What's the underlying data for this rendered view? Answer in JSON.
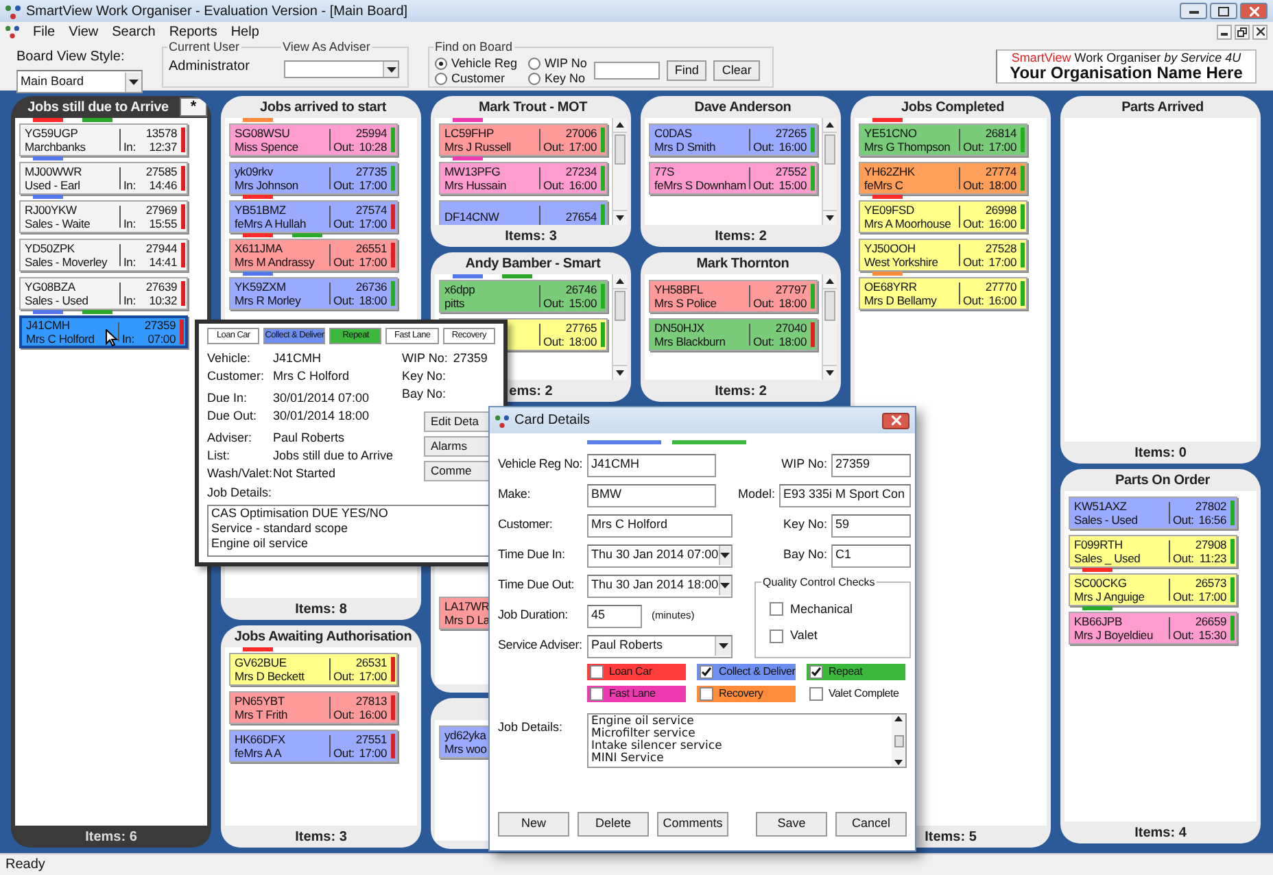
{
  "window": {
    "title": "SmartView Work Organiser - Evaluation Version - [Main Board]"
  },
  "menu": [
    "File",
    "View",
    "Search",
    "Reports",
    "Help"
  ],
  "toolbar": {
    "board_view_style": {
      "label": "Board View Style:",
      "value": "Main Board"
    },
    "current_user": {
      "legend": "Current User",
      "value": "Administrator"
    },
    "view_as_adviser": {
      "label": "View As Adviser"
    },
    "find": {
      "legend": "Find on Board",
      "options": [
        {
          "label": "Vehicle Reg",
          "selected": true
        },
        {
          "label": "WIP No",
          "selected": false
        },
        {
          "label": "Customer",
          "selected": false
        },
        {
          "label": "Key No",
          "selected": false
        }
      ],
      "buttons": [
        "Find",
        "Clear"
      ]
    },
    "logo": {
      "brand": "SmartView",
      "product": "Work Organiser",
      "by": "by Service 4U",
      "organisation": "Your Organisation Name Here"
    }
  },
  "board": {
    "columns": [
      {
        "panels": [
          {
            "title": "Jobs still due to Arrive",
            "action": "*",
            "selected": true,
            "scrollable": false,
            "footer": "Items: 6",
            "cards": [
              {
                "reg": "YG59UGP",
                "name": "Marchbanks",
                "label": "In:",
                "time": "12:37",
                "wip": "13578",
                "color": "#f4f4f4",
                "selected": false,
                "indicator": {
                  "color": "#e02020"
                },
                "flags": [
                  {
                    "color": "#ff2a2a"
                  },
                  {
                    "color": "#2aa82a"
                  }
                ]
              },
              {
                "reg": "MJ00WWR",
                "name": "Used - Earl",
                "label": "In:",
                "time": "14:46",
                "wip": "27585",
                "color": "#f4f4f4",
                "selected": false,
                "indicator": {
                  "color": "#e02020"
                },
                "flags": [
                  {
                    "color": "#5577ee"
                  }
                ]
              },
              {
                "reg": "RJ00YKW",
                "name": "Sales - Waite",
                "label": "In:",
                "time": "15:55",
                "wip": "27969",
                "color": "#f4f4f4",
                "selected": false,
                "indicator": {
                  "color": "#e02020"
                },
                "flags": [
                  {
                    "color": "#5577ee"
                  }
                ]
              },
              {
                "reg": "YD50ZPK",
                "name": "Sales - Moverley",
                "label": "In:",
                "time": "14:41",
                "wip": "27944",
                "color": "#f4f4f4",
                "selected": false,
                "indicator": {
                  "color": "#e02020"
                }
              },
              {
                "reg": "YG08BZA",
                "name": "Sales - Used",
                "label": "In:",
                "time": "10:32",
                "wip": "27639",
                "color": "#f4f4f4",
                "selected": false,
                "indicator": {
                  "color": "#e02020"
                }
              },
              {
                "reg": "J41CMH",
                "name": "Mrs C Holford",
                "label": "In:",
                "time": "07:00",
                "wip": "27359",
                "color": "#3399ff",
                "selected": true,
                "indicator": {
                  "color": "#e02020"
                },
                "flags": [
                  {
                    "color": "#5577ee"
                  },
                  {
                    "color": "#2aa82a"
                  }
                ]
              }
            ]
          }
        ]
      },
      {
        "panels": [
          {
            "title": "Jobs arrived to start",
            "selected": false,
            "scrollable": false,
            "footer": "Items: 8",
            "cards": [
              {
                "reg": "SG08WSU",
                "name": "Miss Spence",
                "label": "Out:",
                "time": "10:28",
                "wip": "25994",
                "color": "#ff9ccf",
                "selected": false,
                "indicator": {
                  "color": "#20b020"
                },
                "flags": [
                  {
                    "color": "#ff8c3a"
                  }
                ]
              },
              {
                "reg": "yk09rkv",
                "name": "Mrs Johnson",
                "label": "Out:",
                "time": "17:00",
                "wip": "27735",
                "color": "#99aaff",
                "selected": false,
                "indicator": {
                  "color": "#20b020"
                }
              },
              {
                "reg": "YB51BMZ",
                "name": "feMrs A Hullah",
                "label": "Out:",
                "time": "17:00",
                "wip": "27574",
                "color": "#99aaff",
                "selected": false,
                "indicator": {
                  "color": "#e02020"
                },
                "flags": [
                  {
                    "color": "#ff2a2a"
                  }
                ]
              },
              {
                "reg": "X611JMA",
                "name": "Mrs M Andrassy",
                "label": "Out:",
                "time": "17:00",
                "wip": "26551",
                "color": "#ff9a9a",
                "selected": false,
                "indicator": {
                  "color": "#e02020"
                },
                "flags": [
                  {
                    "color": "#ff2a2a"
                  },
                  {
                    "color": "#2aa82a"
                  }
                ]
              },
              {
                "reg": "YK59ZXM",
                "name": "Mrs R Morley",
                "label": "Out:",
                "time": "18:00",
                "wip": "26736",
                "color": "#99aaff",
                "selected": false,
                "indicator": {
                  "color": "#20b020"
                },
                "flags": [
                  {
                    "color": "#5577ee"
                  }
                ]
              }
            ]
          },
          {
            "title": "Jobs Awaiting Authorisation",
            "selected": false,
            "scrollable": false,
            "footer": "Items: 3",
            "cards": [
              {
                "reg": "GV62BUE",
                "name": "Mrs D Beckett",
                "label": "Out:",
                "time": "17:00",
                "wip": "26531",
                "color": "#ffff8a",
                "selected": false,
                "indicator": {
                  "color": "#e02020"
                },
                "flags": [
                  {
                    "color": "#ff2a2a"
                  }
                ]
              },
              {
                "reg": "PN65YBT",
                "name": "Mrs T Frith",
                "label": "Out:",
                "time": "16:00",
                "wip": "27813",
                "color": "#ff9a9a",
                "selected": false,
                "indicator": {
                  "color": "#e02020"
                }
              },
              {
                "reg": "HK66DFX",
                "name": "feMrs A A",
                "label": "Out:",
                "time": "17:00",
                "wip": "27551",
                "color": "#99aaff",
                "selected": false,
                "indicator": {
                  "color": "#e02020"
                }
              }
            ]
          }
        ]
      },
      {
        "panels": [
          {
            "title": "Mark Trout - MOT",
            "selected": false,
            "scrollable": true,
            "footer": "Items: 3",
            "cards": [
              {
                "reg": "LC59FHP",
                "name": "Mrs J Russell",
                "label": "Out:",
                "time": "17:00",
                "wip": "27006",
                "color": "#ff9a9a",
                "selected": false,
                "indicator": {
                  "color": "#20b020"
                },
                "flags": [
                  {
                    "color": "#ee3ab0"
                  }
                ]
              },
              {
                "reg": "MW13PFG",
                "name": "Mrs Hussain",
                "label": "Out:",
                "time": "16:00",
                "wip": "27234",
                "color": "#ff9ccf",
                "selected": false,
                "indicator": {
                  "color": "#20b020"
                },
                "flags": [
                  {
                    "color": "#ee3ab0"
                  }
                ]
              },
              {
                "reg": "DF14CNW",
                "wip": "27654",
                "color": "#99aaff",
                "selected": false,
                "indicator": {
                  "color": "#20b020"
                }
              }
            ]
          },
          {
            "title": "Andy Bamber - Smart",
            "selected": false,
            "scrollable": true,
            "footer": "ems: 2",
            "cards": [
              {
                "reg": "x6dpp",
                "name": "pitts",
                "label": "Out:",
                "time": "15:00",
                "wip": "26746",
                "color": "#7acc7a",
                "selected": false,
                "indicator": {
                  "color": "#20b020"
                },
                "flags": [
                  {
                    "color": "#5577ee"
                  },
                  {
                    "color": "#2aa82a"
                  }
                ]
              },
              {
                "label": "Out:",
                "time": "18:00",
                "wip": "27765",
                "color": "#ffff8a",
                "selected": false,
                "indicator": {
                  "color": "#20b020"
                }
              }
            ]
          },
          {
            "selected": false,
            "cards": [
              {
                "reg": "LA17WR",
                "name": "Mrs D La",
                "color": "#ff9a9a",
                "selected": false
              }
            ]
          },
          {
            "selected": false,
            "cards": [
              {
                "reg": "yd62yka",
                "name": "Mrs woo",
                "color": "#99aaff",
                "selected": false
              }
            ]
          }
        ]
      },
      {
        "panels": [
          {
            "title": "Dave Anderson",
            "selected": false,
            "scrollable": true,
            "footer": "Items: 2",
            "cards": [
              {
                "reg": "C0DAS",
                "name": "Mrs D Smith",
                "label": "Out:",
                "time": "16:00",
                "wip": "27265",
                "color": "#99aaff",
                "selected": false,
                "indicator": {
                  "color": "#20b020"
                }
              },
              {
                "reg": "77S",
                "name": "feMrs S Downham",
                "label": "Out:",
                "time": "15:00",
                "wip": "27552",
                "color": "#ff9ccf",
                "selected": false,
                "indicator": {
                  "color": "#20b020"
                }
              }
            ]
          },
          {
            "title": "Mark Thornton",
            "selected": false,
            "scrollable": true,
            "footer": "Items: 2",
            "cards": [
              {
                "reg": "YH58BFL",
                "name": "Mrs S Police",
                "label": "Out:",
                "time": "18:00",
                "wip": "27797",
                "color": "#ff9a9a",
                "selected": false,
                "indicator": {
                  "color": "#20b020"
                }
              },
              {
                "reg": "DN50HJX",
                "name": "Mrs Blackburn",
                "label": "Out:",
                "time": "18:00",
                "wip": "27040",
                "color": "#7acc7a",
                "selected": false,
                "indicator": {
                  "color": "#e02020"
                }
              }
            ]
          }
        ]
      },
      {
        "panels": [
          {
            "title": "Jobs Completed",
            "selected": false,
            "scrollable": false,
            "footer": "Items: 5",
            "cards": [
              {
                "reg": "YE51CNO",
                "name": "Mrs G Thompson",
                "label": "Out:",
                "time": "17:00",
                "wip": "26814",
                "color": "#7acc7a",
                "selected": false,
                "indicator": {
                  "color": "#20b020"
                },
                "flags": [
                  {
                    "color": "#ff2a2a"
                  }
                ]
              },
              {
                "reg": "YH62ZHK",
                "name": "feMrs C",
                "label": "Out:",
                "time": "18:00",
                "wip": "27774",
                "color": "#ff9f5a",
                "selected": false,
                "indicator": {
                  "color": "#20b020"
                }
              },
              {
                "reg": "YE09FSD",
                "name": "Mrs A Moorhouse",
                "label": "Out:",
                "time": "16:00",
                "wip": "26998",
                "color": "#ffff8a",
                "selected": false,
                "indicator": {
                  "color": "#20b020"
                },
                "flags": [
                  {
                    "color": "#ff2a2a"
                  }
                ]
              },
              {
                "reg": "YJ50OOH",
                "name": "West Yorkshire",
                "label": "Out:",
                "time": "17:00",
                "wip": "27528",
                "color": "#ffff8a",
                "selected": false,
                "indicator": {
                  "color": "#20b020"
                }
              },
              {
                "reg": "OE68YRR",
                "name": "Mrs D Bellamy",
                "label": "Out:",
                "time": "16:00",
                "wip": "27770",
                "color": "#ffff8a",
                "selected": false,
                "indicator": {
                  "color": "#20b020"
                },
                "flags": [
                  {
                    "color": "#ff8c3a"
                  }
                ]
              }
            ]
          }
        ]
      },
      {
        "panels": [
          {
            "title": "Parts Arrived",
            "selected": false,
            "scrollable": false,
            "footer": "Items: 0"
          },
          {
            "title": "Parts On Order",
            "selected": false,
            "scrollable": false,
            "footer": "Items: 4",
            "cards": [
              {
                "reg": "KW51AXZ",
                "name": "Sales - Used",
                "label": "Out:",
                "time": "16:56",
                "wip": "27802",
                "color": "#99aaff",
                "selected": false,
                "indicator": {
                  "color": "#20b020"
                }
              },
              {
                "reg": "F099RTH",
                "name": "Sales _ Used",
                "label": "Out:",
                "time": "11:23",
                "wip": "27908",
                "color": "#ffff8a",
                "selected": false,
                "indicator": {
                  "color": "#20b020"
                }
              },
              {
                "reg": "SC00CKG",
                "name": "Mrs J Anguige",
                "label": "Out:",
                "time": "17:00",
                "wip": "26573",
                "color": "#ffff8a",
                "selected": false,
                "indicator": {
                  "color": "#20b020"
                },
                "flags": [
                  {
                    "color": "#ff2a2a"
                  }
                ]
              },
              {
                "reg": "KB66JPB",
                "name": "Mrs J Boyeldieu",
                "label": "Out:",
                "time": "15:30",
                "wip": "26659",
                "color": "#ff9ccf",
                "selected": false,
                "indicator": {
                  "color": "#20b020"
                },
                "flags": [
                  {
                    "color": "#2aa82a"
                  }
                ]
              }
            ]
          }
        ]
      }
    ]
  },
  "hover_card": {
    "tabs": [
      {
        "label": "Loan Car",
        "on": false
      },
      {
        "label": "Collect & Deliver",
        "color": "#6f8ff0",
        "on": true
      },
      {
        "label": "Repeat",
        "color": "#3cb83c",
        "on": true
      },
      {
        "label": "Fast Lane",
        "on": false
      },
      {
        "label": "Recovery",
        "on": false
      }
    ],
    "fields": [
      {
        "label": "Vehicle:",
        "value": "J41CMH"
      },
      {
        "label": "Customer:",
        "value": "Mrs C Holford"
      },
      {
        "label": "Due In:",
        "value": "30/01/2014 07:00"
      },
      {
        "label": "Due Out:",
        "value": "30/01/2014 18:00"
      },
      {
        "label": "Adviser:",
        "value": "Paul Roberts"
      },
      {
        "label": "List:",
        "value": "Jobs still due to Arrive"
      },
      {
        "label": "Wash/Valet:",
        "value": "Not Started"
      }
    ],
    "side_fields": [
      {
        "label": "WIP No:",
        "value": "27359"
      },
      {
        "label": "Key No:"
      },
      {
        "label": "Bay No:"
      }
    ],
    "job_details_label": "Job Details:",
    "job_details": [
      "CAS Optimisation DUE YES/NO",
      "Service - standard scope",
      "Engine oil service"
    ],
    "buttons": [
      "Edit Deta",
      "Alarms",
      "Comme"
    ]
  },
  "dialog": {
    "title": "Card Details",
    "flags": [
      {
        "color": "#5a7ee8"
      },
      {
        "color": "#3cb83c"
      }
    ],
    "left_fields": [
      {
        "kind": "text",
        "label": "Vehicle Reg No:",
        "value": "J41CMH"
      },
      {
        "kind": "text",
        "label": "Make:",
        "value": "BMW"
      },
      {
        "kind": "wide",
        "label": "Customer:",
        "value": "Mrs C Holford"
      },
      {
        "kind": "select",
        "label": "Time Due In:",
        "value": "Thu 30 Jan 2014 07:00"
      },
      {
        "kind": "select",
        "label": "Time Due Out:",
        "value": "Thu 30 Jan 2014 18:00"
      },
      {
        "kind": "short",
        "label": "Job Duration:",
        "value": "45",
        "unit": "(minutes)"
      },
      {
        "kind": "select",
        "label": "Service Adviser:",
        "value": "Paul Roberts"
      }
    ],
    "right_fields": [
      {
        "kind": "short",
        "label": "WIP No:",
        "value": "27359"
      },
      {
        "kind": "wide",
        "label": "Model:",
        "value": "E93 335i M Sport Con"
      },
      {
        "kind": "short",
        "label": "Key No:",
        "value": "59"
      },
      {
        "kind": "short",
        "label": "Bay No:",
        "value": "C1"
      }
    ],
    "quality": {
      "legend": "Quality Control Checks",
      "items": [
        {
          "label": "Mechanical",
          "checked": false
        },
        {
          "label": "Valet",
          "checked": false
        }
      ]
    },
    "options": [
      {
        "label": "Loan Car",
        "color": "#ff3b3b",
        "checked": false
      },
      {
        "label": "Collect & Deliver",
        "color": "#6f8ff0",
        "checked": true
      },
      {
        "label": "Repeat",
        "color": "#3cb83c",
        "checked": true
      },
      {
        "label": "Fast Lane",
        "color": "#ee3ab0",
        "checked": false
      },
      {
        "label": "Recovery",
        "color": "#ff8c3a",
        "checked": false
      },
      {
        "label": "Valet Complete",
        "checked": false
      }
    ],
    "job_details_label": "Job Details:",
    "job_details": [
      "Engine oil service",
      "Microfilter service",
      "Intake silencer service",
      "MINI Service"
    ],
    "left_buttons": [
      "New",
      "Delete",
      "Comments"
    ],
    "right_buttons": [
      "Save",
      "Cancel"
    ]
  },
  "status_bar": "Ready"
}
